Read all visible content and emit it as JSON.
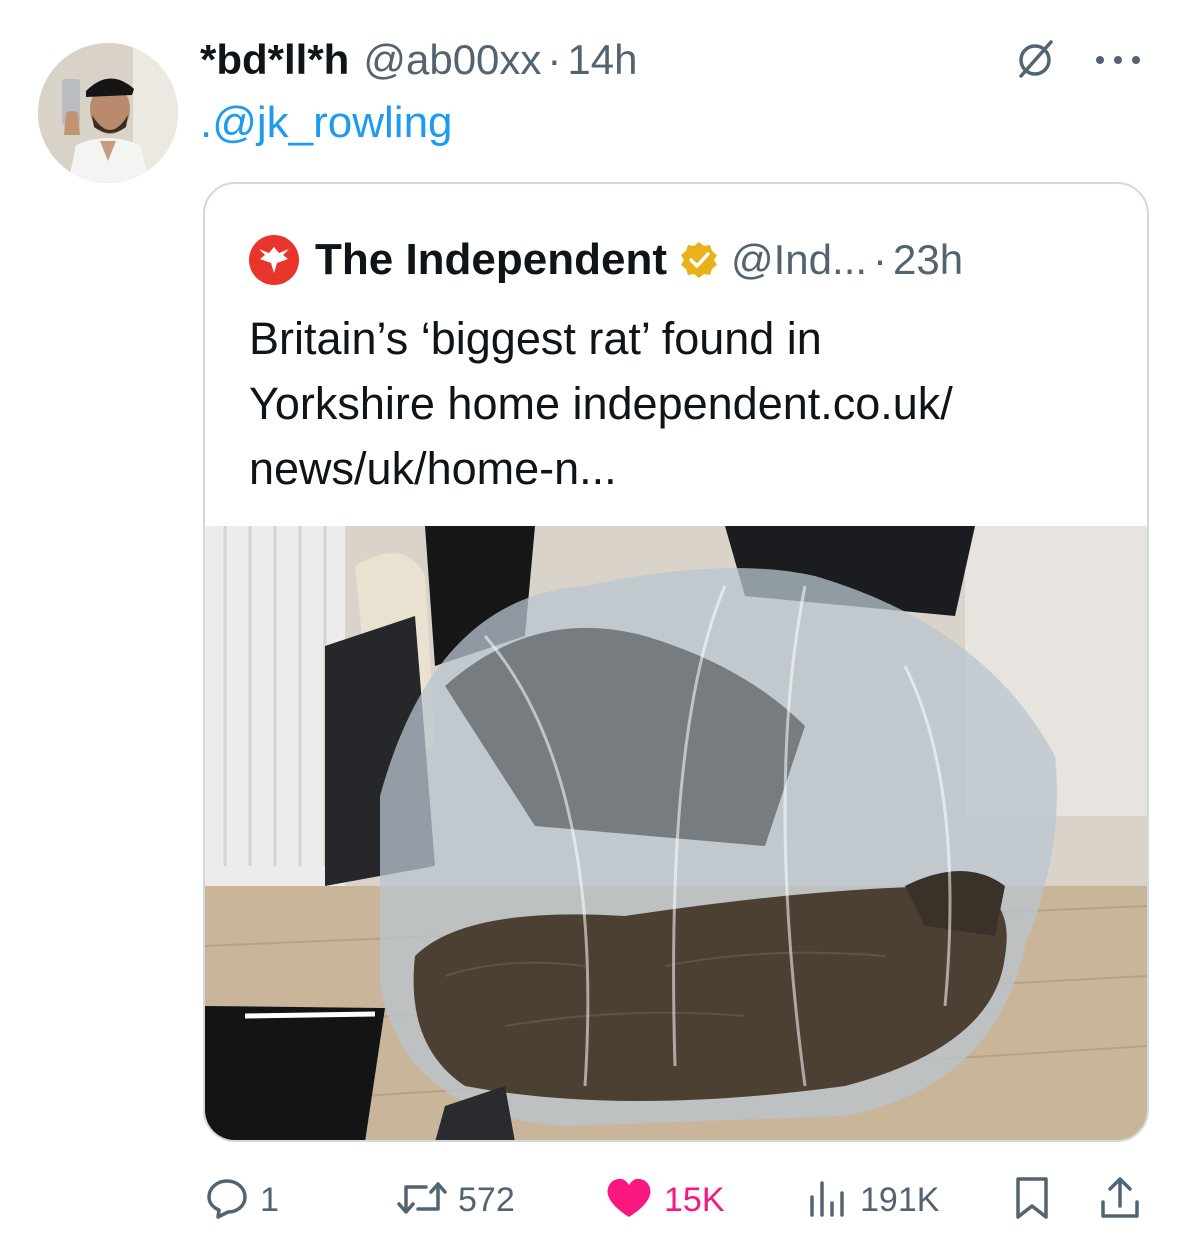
{
  "author": {
    "display_name": "*bd*ll*h",
    "handle": "@ab00xx",
    "separator": "·",
    "time": "14h",
    "avatar_icon": "profile-photo"
  },
  "tweet": {
    "text": ".@jk_rowling"
  },
  "quoted": {
    "display_name": "The Independent",
    "verified_icon": "verified-badge-gold",
    "handle": "@Ind...",
    "separator": "·",
    "time": "23h",
    "text_lines": [
      "Britain’s ‘biggest rat’ found in",
      "Yorkshire home independent.co.uk/",
      "news/uk/home-n..."
    ],
    "media_icon": "photo-rat-in-plastic-bag"
  },
  "actions": {
    "reply_count": "1",
    "retweet_count": "572",
    "like_count": "15K",
    "views_count": "191K"
  },
  "colors": {
    "link": "#1d9bf0",
    "like": "#f91880",
    "muted": "#536471",
    "brand_red": "#e8352b",
    "verified_gold": "#e8b219"
  }
}
